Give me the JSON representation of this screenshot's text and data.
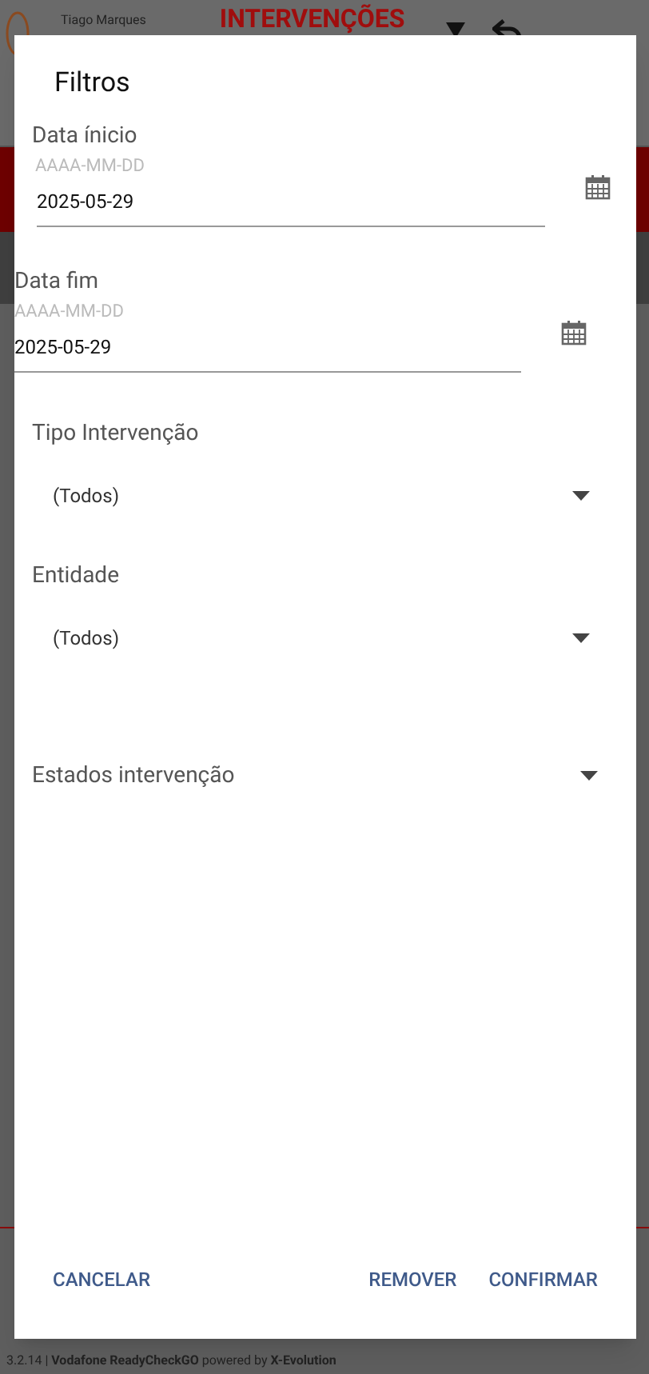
{
  "background": {
    "user_name": "Tiago Marques",
    "title": "INTERVENÇÕES",
    "footer": "3.2.14 | **Vodafone ReadyCheckGO** powered by **X-Evolution**"
  },
  "dialog": {
    "title": "Filtros",
    "fields": [
      {
        "kind": "date",
        "label": "Data ínicio",
        "hint": "AAAA-MM-DD",
        "value": "2025-05-29"
      },
      {
        "kind": "date",
        "label": "Data fim",
        "hint": "AAAA-MM-DD",
        "value": "2025-05-29"
      },
      {
        "kind": "select",
        "label": "Tipo Intervenção",
        "value": "(Todos)"
      },
      {
        "kind": "select",
        "label": "Entidade",
        "value": "(Todos)"
      },
      {
        "kind": "multiselect",
        "label": "Estados intervenção"
      }
    ],
    "buttons": [
      "CANCELAR",
      "REMOVER",
      "CONFIRMAR"
    ]
  }
}
